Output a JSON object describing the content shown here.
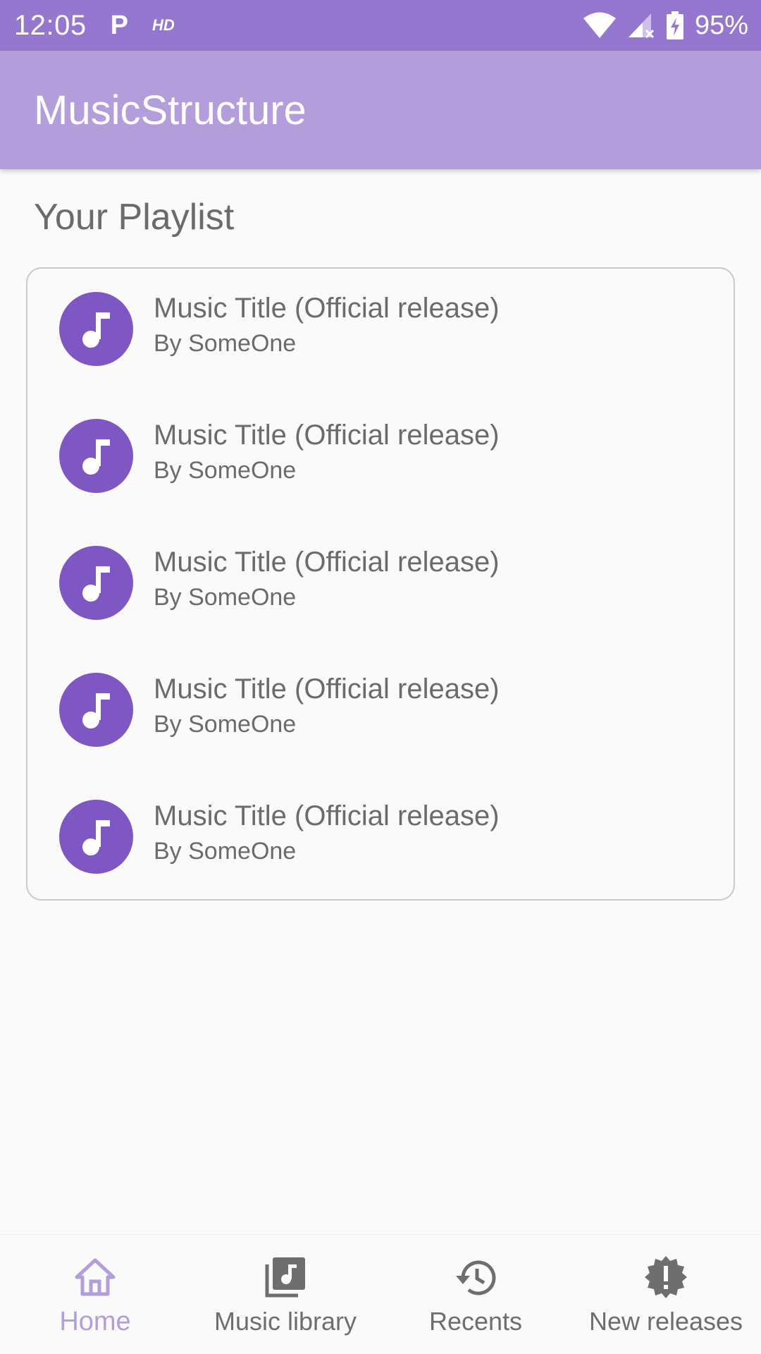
{
  "status_bar": {
    "time": "12:05",
    "p_indicator": "P",
    "hd_indicator": "HD",
    "battery_percent": "95%"
  },
  "app_bar": {
    "title": "MusicStructure"
  },
  "main": {
    "section_title": "Your Playlist",
    "tracks": [
      {
        "title": "Music Title (Official release)",
        "artist": "By SomeOne",
        "icon": "music-note-icon"
      },
      {
        "title": "Music Title (Official release)",
        "artist": "By SomeOne",
        "icon": "music-note-icon"
      },
      {
        "title": "Music Title (Official release)",
        "artist": "By SomeOne",
        "icon": "music-note-icon"
      },
      {
        "title": "Music Title (Official release)",
        "artist": "By SomeOne",
        "icon": "music-note-icon"
      },
      {
        "title": "Music Title (Official release)",
        "artist": "By SomeOne",
        "icon": "music-note-icon"
      }
    ]
  },
  "bottom_nav": {
    "items": [
      {
        "label": "Home",
        "icon": "home-icon",
        "active": true
      },
      {
        "label": "Music library",
        "icon": "library-music-icon",
        "active": false
      },
      {
        "label": "Recents",
        "icon": "history-icon",
        "active": false
      },
      {
        "label": "New releases",
        "icon": "new-releases-icon",
        "active": false
      }
    ]
  },
  "colors": {
    "status_bar": "#9677cf",
    "app_bar": "#b39ddb",
    "accent": "#7e57c2",
    "text_secondary": "#6b6b6b"
  }
}
